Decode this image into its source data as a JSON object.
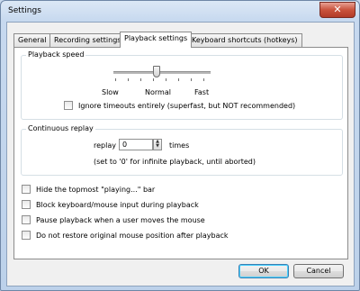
{
  "window": {
    "title": "Settings",
    "close_icon": "close-icon"
  },
  "tabs": [
    {
      "label": "General",
      "active": false
    },
    {
      "label": "Recording settings",
      "active": false
    },
    {
      "label": "Playback settings",
      "active": true
    },
    {
      "label": "Keyboard shortcuts (hotkeys)",
      "active": false
    }
  ],
  "playback_speed": {
    "title": "Playback speed",
    "labels": {
      "slow": "Slow",
      "normal": "Normal",
      "fast": "Fast"
    },
    "slider_value": "Normal",
    "ignore_timeouts": {
      "label": "Ignore timeouts entirely (superfast, but NOT recommended)",
      "checked": false
    }
  },
  "continuous_replay": {
    "title": "Continuous replay",
    "replay_label": "replay",
    "value": "0",
    "times_label": "times",
    "hint": "(set to '0' for infinite playback, until aborted)"
  },
  "options": [
    {
      "label": "Hide the topmost \"playing...\" bar",
      "checked": false
    },
    {
      "label": "Block keyboard/mouse input during playback",
      "checked": false
    },
    {
      "label": "Pause playback when a user moves the mouse",
      "checked": false
    },
    {
      "label": "Do not restore original mouse position after playback",
      "checked": false
    }
  ],
  "buttons": {
    "ok": "OK",
    "cancel": "Cancel"
  }
}
